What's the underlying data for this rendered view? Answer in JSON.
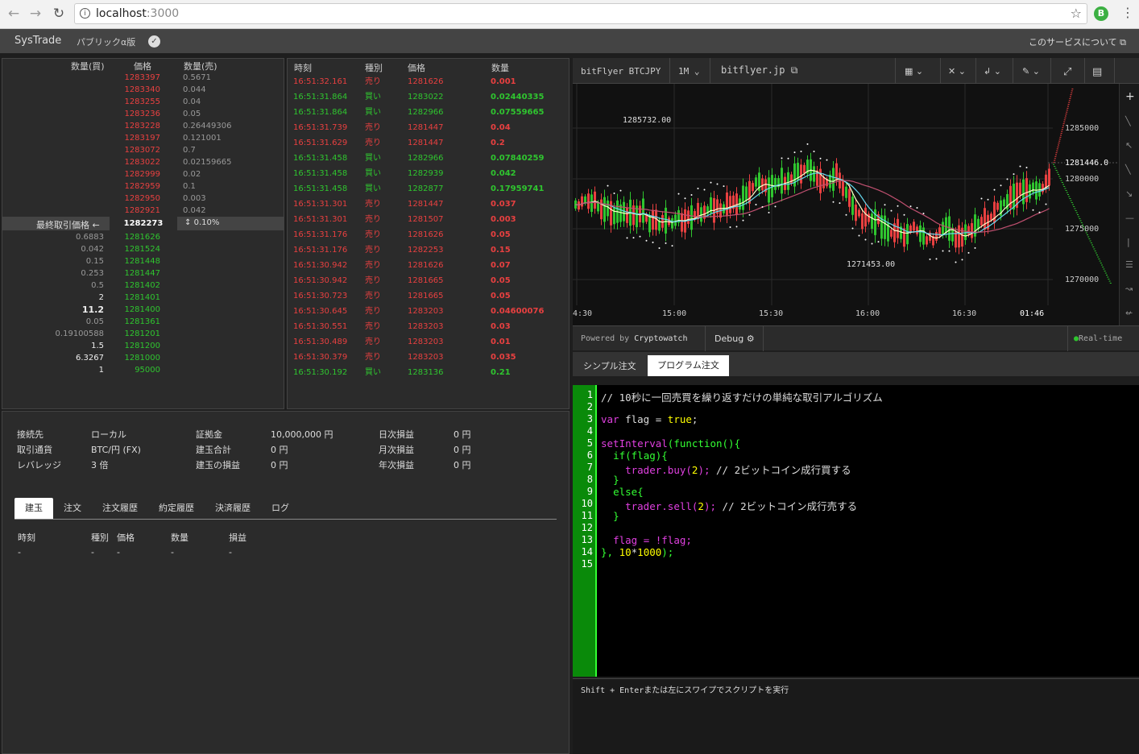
{
  "browser": {
    "url_host": "localhost",
    "url_port": ":3000",
    "ext": "B"
  },
  "app": {
    "logo": "SysTrade",
    "beta": "パブリックα版",
    "about": "このサービスについて"
  },
  "orderbook": {
    "h_buy": "数量(買)",
    "h_price": "価格",
    "h_sell": "数量(売)",
    "asks": [
      [
        "1283397",
        "0.5671"
      ],
      [
        "1283340",
        "0.044"
      ],
      [
        "1283255",
        "0.04"
      ],
      [
        "1283236",
        "0.05"
      ],
      [
        "1283228",
        "0.26449306"
      ],
      [
        "1283197",
        "0.121001"
      ],
      [
        "1283072",
        "0.7"
      ],
      [
        "1283022",
        "0.02159665"
      ],
      [
        "1282999",
        "0.02"
      ],
      [
        "1282959",
        "0.1"
      ],
      [
        "1282950",
        "0.003"
      ],
      [
        "1282921",
        "0.042"
      ]
    ],
    "last_label": "最終取引価格",
    "last_price": "1282273",
    "last_pct": "0.10%",
    "bids": [
      [
        "0.6883",
        "1281626"
      ],
      [
        "0.042",
        "1281524"
      ],
      [
        "0.15",
        "1281448"
      ],
      [
        "0.253",
        "1281447"
      ],
      [
        "0.5",
        "1281402"
      ],
      [
        "2",
        "1281401"
      ],
      [
        "11.2",
        "1281400"
      ],
      [
        "0.05",
        "1281361"
      ],
      [
        "0.19100588",
        "1281201"
      ],
      [
        "1.5",
        "1281200"
      ],
      [
        "6.3267",
        "1281000"
      ],
      [
        "1",
        "95000"
      ]
    ]
  },
  "trades": {
    "h_time": "時刻",
    "h_type": "種別",
    "h_price": "価格",
    "h_qty": "数量",
    "rows": [
      [
        "16:51:32.161",
        "売り",
        "1281626",
        "0.001"
      ],
      [
        "16:51:31.864",
        "買い",
        "1283022",
        "0.02440335"
      ],
      [
        "16:51:31.864",
        "買い",
        "1282966",
        "0.07559665"
      ],
      [
        "16:51:31.739",
        "売り",
        "1281447",
        "0.04"
      ],
      [
        "16:51:31.629",
        "売り",
        "1281447",
        "0.2"
      ],
      [
        "16:51:31.458",
        "買い",
        "1282966",
        "0.07840259"
      ],
      [
        "16:51:31.458",
        "買い",
        "1282939",
        "0.042"
      ],
      [
        "16:51:31.458",
        "買い",
        "1282877",
        "0.17959741"
      ],
      [
        "16:51:31.301",
        "売り",
        "1281447",
        "0.037"
      ],
      [
        "16:51:31.301",
        "売り",
        "1281507",
        "0.003"
      ],
      [
        "16:51:31.176",
        "売り",
        "1281626",
        "0.05"
      ],
      [
        "16:51:31.176",
        "売り",
        "1282253",
        "0.15"
      ],
      [
        "16:51:30.942",
        "売り",
        "1281626",
        "0.07"
      ],
      [
        "16:51:30.942",
        "売り",
        "1281665",
        "0.05"
      ],
      [
        "16:51:30.723",
        "売り",
        "1281665",
        "0.05"
      ],
      [
        "16:51:30.645",
        "売り",
        "1283203",
        "0.04600076"
      ],
      [
        "16:51:30.551",
        "売り",
        "1283203",
        "0.03"
      ],
      [
        "16:51:30.489",
        "売り",
        "1283203",
        "0.01"
      ],
      [
        "16:51:30.379",
        "売り",
        "1283203",
        "0.035"
      ],
      [
        "16:51:30.192",
        "買い",
        "1283136",
        "0.21"
      ]
    ]
  },
  "account": {
    "conn_l": "接続先",
    "conn_v": "ローカル",
    "pair_l": "取引通貨",
    "pair_v": "BTC/円 (FX)",
    "lev_l": "レバレッジ",
    "lev_v": "3 倍",
    "margin_l": "証拠金",
    "margin_v": "10,000,000 円",
    "pos_l": "建玉合計",
    "pos_v": "0 円",
    "pnl_l": "建玉の損益",
    "pnl_v": "0 円",
    "day_l": "日次損益",
    "day_v": "0 円",
    "mon_l": "月次損益",
    "mon_v": "0 円",
    "year_l": "年次損益",
    "year_v": "0 円"
  },
  "tabs": [
    "建玉",
    "注文",
    "注文履歴",
    "約定履歴",
    "決済履歴",
    "ログ"
  ],
  "pos_table": {
    "cols": [
      "時刻",
      "種別",
      "価格",
      "数量",
      "損益"
    ],
    "dash": "-"
  },
  "chart": {
    "exchange": "bitFlyer BTCJPY",
    "interval": "1M",
    "site": "bitflyer.jp",
    "high": "1285732.00",
    "low": "1271453.00",
    "cur": "1281446.0",
    "yticks": [
      "1285000",
      "1280000",
      "1275000",
      "1270000"
    ],
    "xticks": [
      "4:30",
      "15:00",
      "15:30",
      "16:00",
      "16:30",
      "01:46"
    ],
    "powered": "Powered by",
    "cw": "Cryptowatch",
    "debug": "Debug",
    "rt": "Real-time"
  },
  "order_tabs": {
    "simple": "シンプル注文",
    "program": "プログラム注文"
  },
  "code_lines": [
    "1",
    "2",
    "3",
    "4",
    "5",
    "6",
    "7",
    "8",
    "9",
    "10",
    "11",
    "12",
    "13",
    "14",
    "15"
  ],
  "code": {
    "c1": "// 10秒に一回売買を繰り返すだけの単純な取引アルゴリズム",
    "var": "var",
    "flag": " flag = ",
    "true": "true",
    ";": ";",
    "setInterval": "setInterval",
    "fn": "(function(){",
    "if": "if",
    "ifc": "(flag){",
    "trader": "trader",
    "buy": ".buy(",
    "two": "2",
    "close": ");",
    "cbuy": " // 2ビットコイン成行買する",
    "rb": "}",
    "else": "else{",
    "sell": ".sell(",
    "csell": " // 2ビットコイン成行売する",
    "flagset": "flag = !flag;",
    "end1": "}, ",
    "ten": "10",
    "mul": "*",
    "thousand": "1000",
    "end2": ");"
  },
  "hint": "Shift + Enterまたは左にスワイプでスクリプトを実行"
}
